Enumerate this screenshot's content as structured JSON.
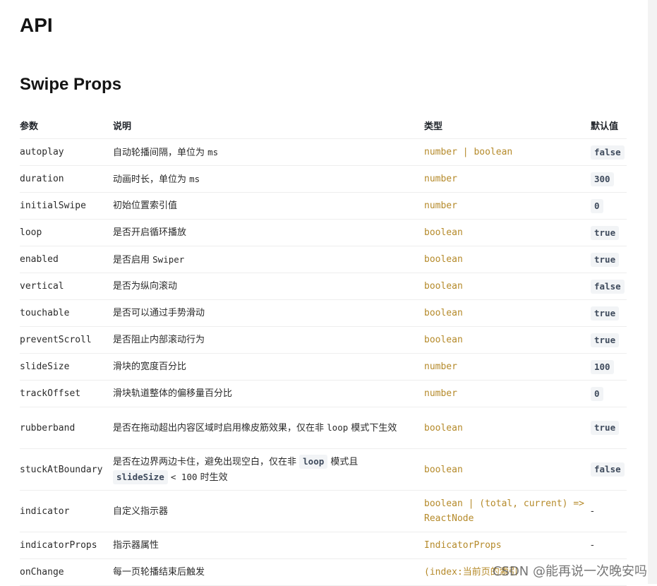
{
  "page": {
    "title": "API",
    "section_title": "Swipe Props"
  },
  "table": {
    "headers": {
      "name": "参数",
      "desc": "说明",
      "type": "类型",
      "default": "默认值"
    },
    "rows": [
      {
        "name": "autoplay",
        "desc": [
          "自动轮播间隔，单位为 ",
          {
            "code": "ms"
          }
        ],
        "type": "number | boolean",
        "default": "false"
      },
      {
        "name": "duration",
        "desc": [
          "动画时长，单位为 ",
          {
            "code": "ms"
          }
        ],
        "type": "number",
        "default": "300"
      },
      {
        "name": "initialSwipe",
        "desc": [
          "初始位置索引值"
        ],
        "type": "number",
        "default": "0"
      },
      {
        "name": "loop",
        "desc": [
          "是否开启循环播放"
        ],
        "type": "boolean",
        "default": "true"
      },
      {
        "name": "enabled",
        "desc": [
          "是否启用 ",
          {
            "code": "Swiper"
          }
        ],
        "type": "boolean",
        "default": "true"
      },
      {
        "name": "vertical",
        "desc": [
          "是否为纵向滚动"
        ],
        "type": "boolean",
        "default": "false"
      },
      {
        "name": "touchable",
        "desc": [
          "是否可以通过手势滑动"
        ],
        "type": "boolean",
        "default": "true"
      },
      {
        "name": "preventScroll",
        "desc": [
          "是否阻止内部滚动行为"
        ],
        "type": "boolean",
        "default": "true"
      },
      {
        "name": "slideSize",
        "desc": [
          "滑块的宽度百分比"
        ],
        "type": "number",
        "default": "100"
      },
      {
        "name": "trackOffset",
        "desc": [
          "滑块轨道整体的偏移量百分比"
        ],
        "type": "number",
        "default": "0"
      },
      {
        "name": "rubberband",
        "desc": [
          "是否在拖动超出内容区域时启用橡皮筋效果，仅在非 ",
          {
            "code": "loop"
          },
          " 模式下生效"
        ],
        "type": "boolean",
        "default": "true"
      },
      {
        "name": "stuckAtBoundary",
        "desc": [
          "是否在边界两边卡住，避免出现空白，仅在非 ",
          {
            "badge": "loop"
          },
          " 模式且 ",
          {
            "badge": "slideSize"
          },
          " ",
          {
            "code": "< 100"
          },
          " 时生效"
        ],
        "type": "boolean",
        "default": "false"
      },
      {
        "name": "indicator",
        "desc": [
          "自定义指示器"
        ],
        "type": "boolean | (total, current) => ReactNode",
        "default": "-"
      },
      {
        "name": "indicatorProps",
        "desc": [
          "指示器属性"
        ],
        "type": "IndicatorProps",
        "default": "-"
      },
      {
        "name": "onChange",
        "desc": [
          "每一页轮播结束后触发"
        ],
        "type": "(index:当前页的索引",
        "default": ""
      }
    ]
  },
  "watermark": "CSDN @能再说一次晚安吗",
  "colors": {
    "type_text": "#b58a2a",
    "code_bg": "#f2f4f6"
  }
}
